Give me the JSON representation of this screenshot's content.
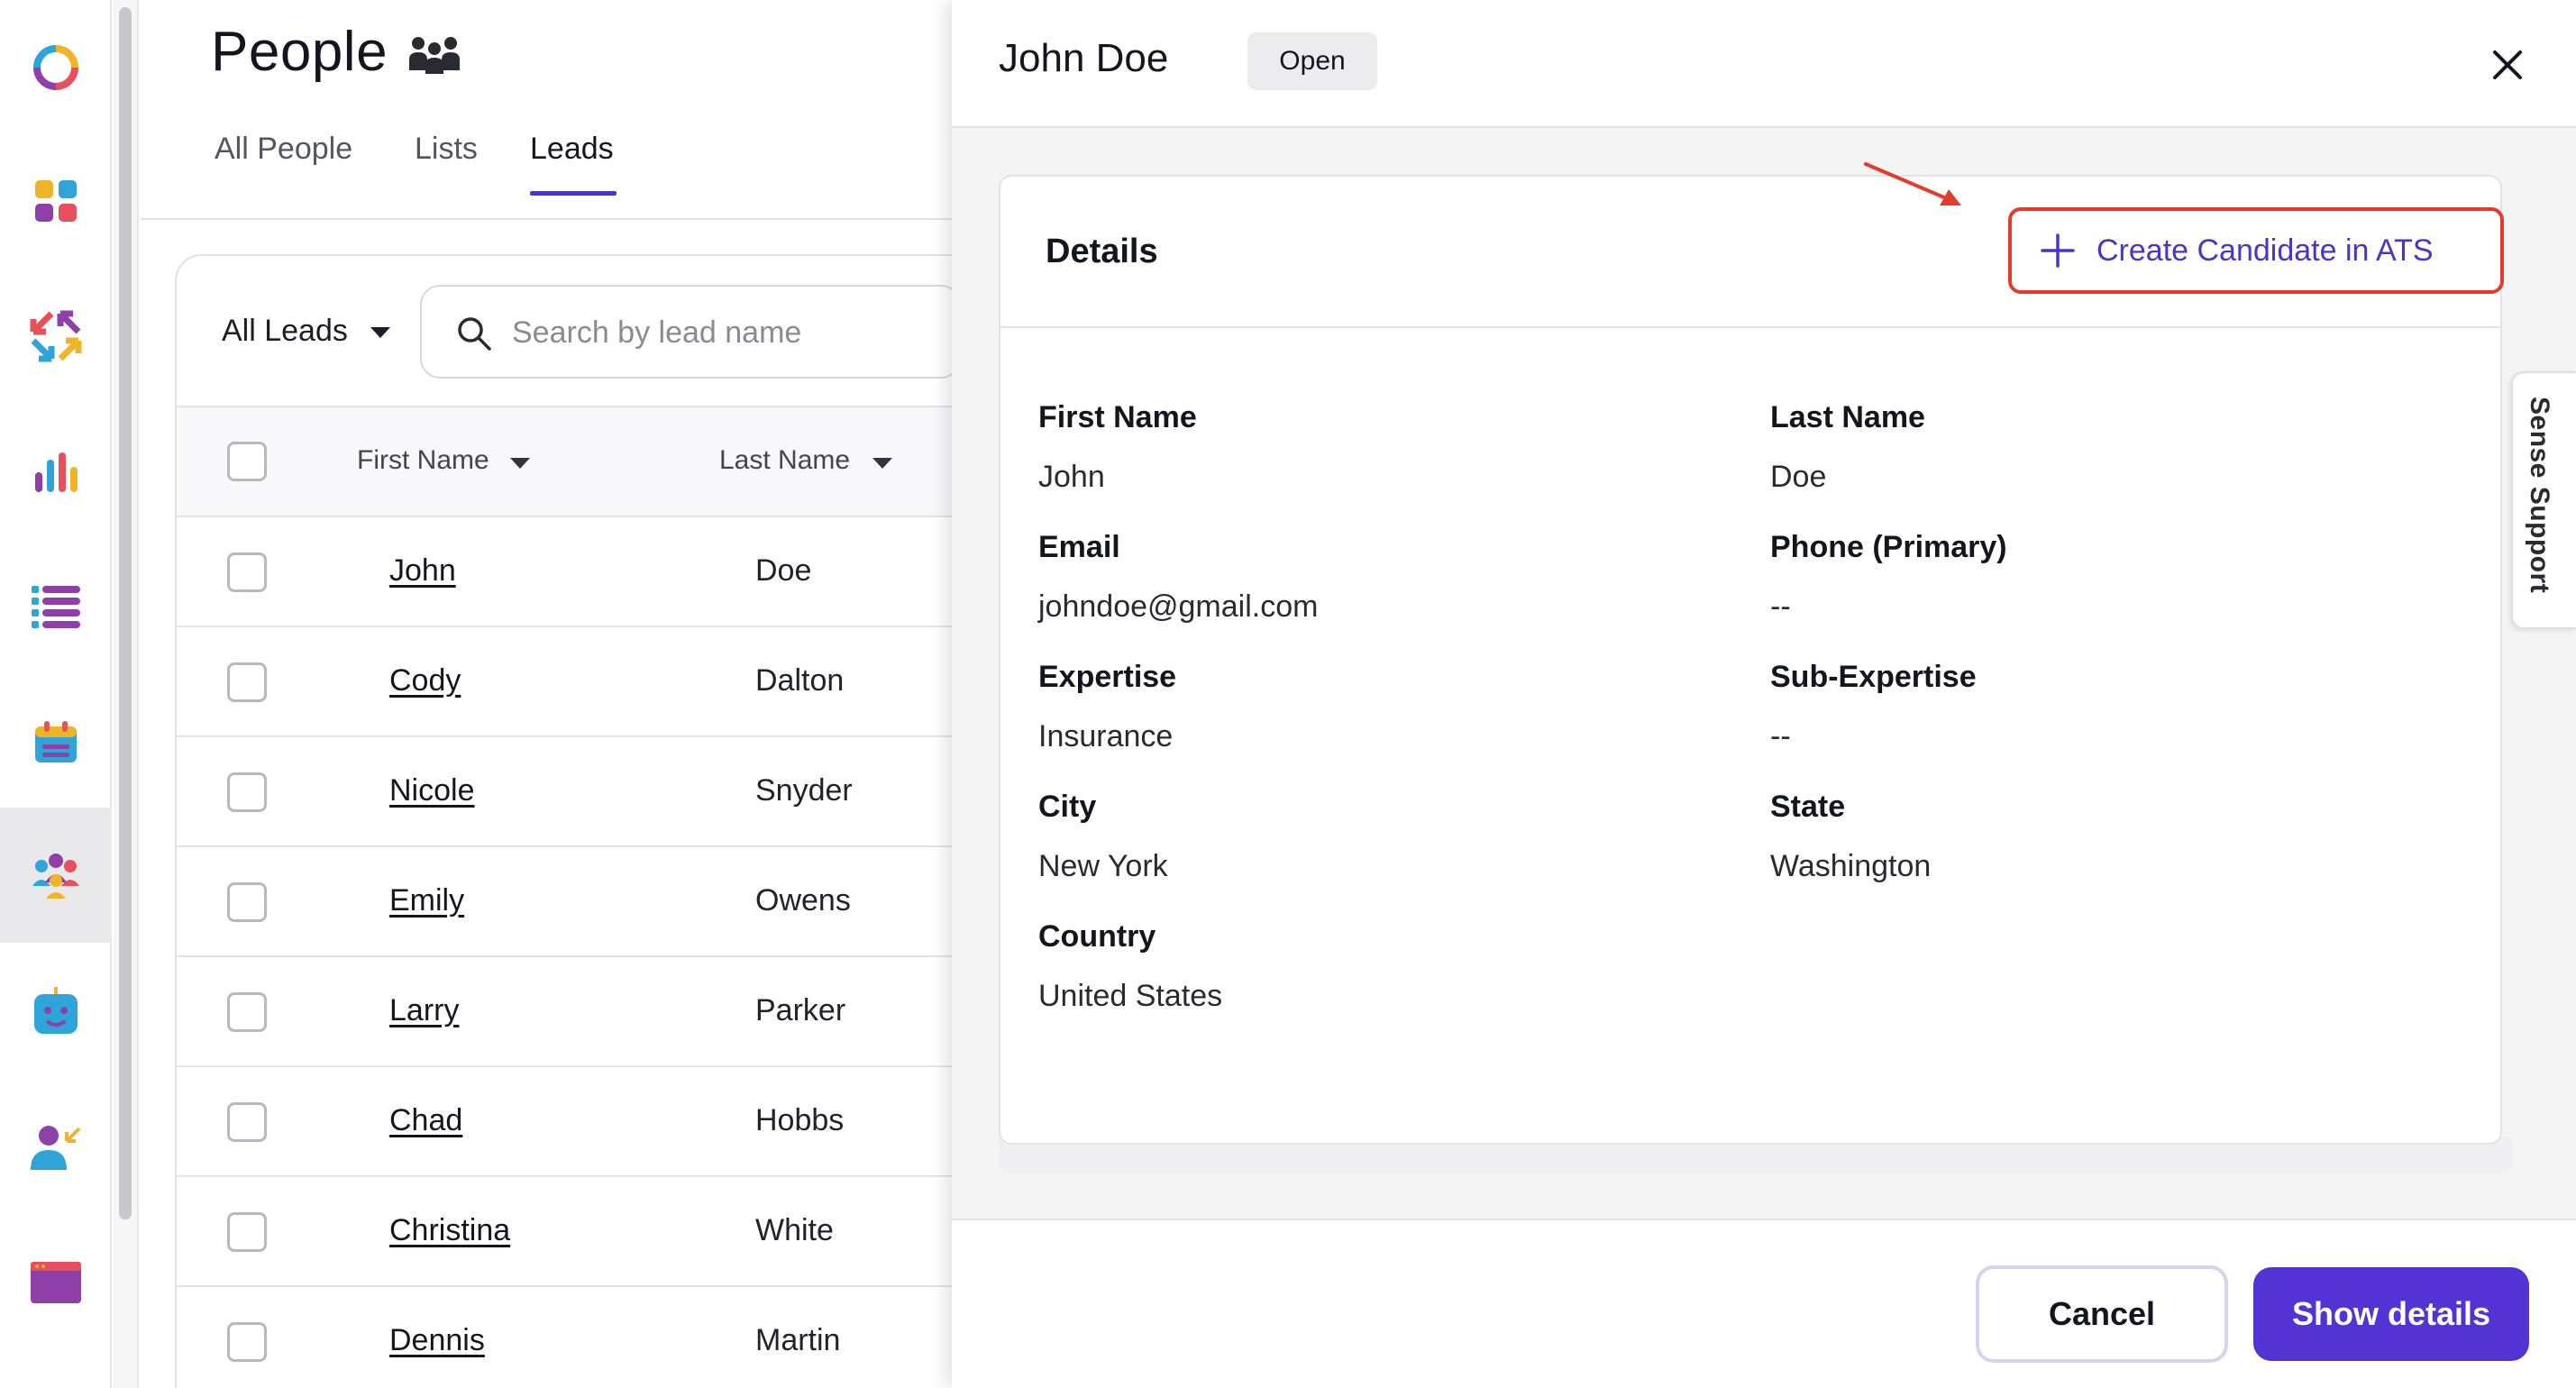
{
  "page": {
    "title": "People",
    "tabs": [
      "All People",
      "Lists",
      "Leads"
    ],
    "active_tab": "Leads",
    "filter_label": "All Leads",
    "search_placeholder": "Search by lead name",
    "columns": [
      "First Name",
      "Last Name"
    ],
    "rows": [
      {
        "first": "John",
        "last": "Doe"
      },
      {
        "first": "Cody",
        "last": "Dalton"
      },
      {
        "first": "Nicole",
        "last": "Snyder"
      },
      {
        "first": "Emily",
        "last": "Owens"
      },
      {
        "first": "Larry",
        "last": "Parker"
      },
      {
        "first": "Chad",
        "last": "Hobbs"
      },
      {
        "first": "Christina",
        "last": "White"
      },
      {
        "first": "Dennis",
        "last": "Martin"
      }
    ]
  },
  "rail": {
    "icons": [
      "logo-ring-icon",
      "dashboard-grid-icon",
      "arrows-icon",
      "bar-chart-icon",
      "list-icon",
      "calendar-icon",
      "people-icon",
      "bot-icon",
      "person-arrow-icon",
      "browser-window-icon"
    ],
    "active": "people-icon"
  },
  "drawer": {
    "title": "John Doe",
    "status": "Open",
    "details_heading": "Details",
    "create_label": "Create Candidate in ATS",
    "fields": [
      {
        "label": "First Name",
        "value": "John"
      },
      {
        "label": "Last Name",
        "value": "Doe"
      },
      {
        "label": "Email",
        "value": "johndoe@gmail.com"
      },
      {
        "label": "Phone (Primary)",
        "value": "--"
      },
      {
        "label": "Expertise",
        "value": "Insurance"
      },
      {
        "label": "Sub-Expertise",
        "value": "--"
      },
      {
        "label": "City",
        "value": "New York"
      },
      {
        "label": "State",
        "value": "Washington"
      },
      {
        "label": "Country",
        "value": "United States"
      }
    ],
    "support_label": "Sense Support",
    "cancel_label": "Cancel",
    "show_details_label": "Show details"
  },
  "colors": {
    "accent": "#5333d4",
    "annotation": "#e33b2c"
  }
}
